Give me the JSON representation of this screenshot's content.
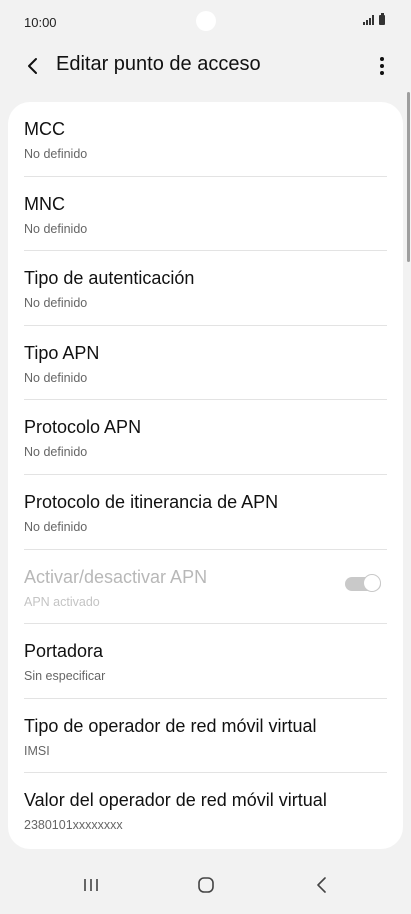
{
  "status_bar": {
    "time": "10:00",
    "icons": [
      "signal-icon",
      "battery-icon"
    ]
  },
  "header": {
    "title": "Editar punto de acceso",
    "back_icon": "back-arrow-icon",
    "menu_icon": "more-vertical-icon"
  },
  "settings": [
    {
      "title": "MCC",
      "subtitle": "No definido"
    },
    {
      "title": "MNC",
      "subtitle": "No definido"
    },
    {
      "title": "Tipo de autenticación",
      "subtitle": "No definido"
    },
    {
      "title": "Tipo APN",
      "subtitle": "No definido"
    },
    {
      "title": "Protocolo APN",
      "subtitle": "No definido"
    },
    {
      "title": "Protocolo de itinerancia de APN",
      "subtitle": "No definido"
    },
    {
      "title": "Activar/desactivar APN",
      "subtitle": "APN activado",
      "toggle": true,
      "enabled": false
    },
    {
      "title": "Portadora",
      "subtitle": "Sin especificar"
    },
    {
      "title": "Tipo de operador de red móvil virtual",
      "subtitle": "IMSI"
    },
    {
      "title": "Valor del operador de red móvil virtual",
      "subtitle": "2380101xxxxxxxx"
    }
  ],
  "nav_bar": {
    "icons": [
      "recent-apps-icon",
      "home-icon",
      "back-icon"
    ]
  },
  "colors": {
    "background": "#f2f2f2",
    "card": "#ffffff",
    "disabled_text": "#b8b8b8",
    "toggle_disabled": "#c9c9c9"
  }
}
